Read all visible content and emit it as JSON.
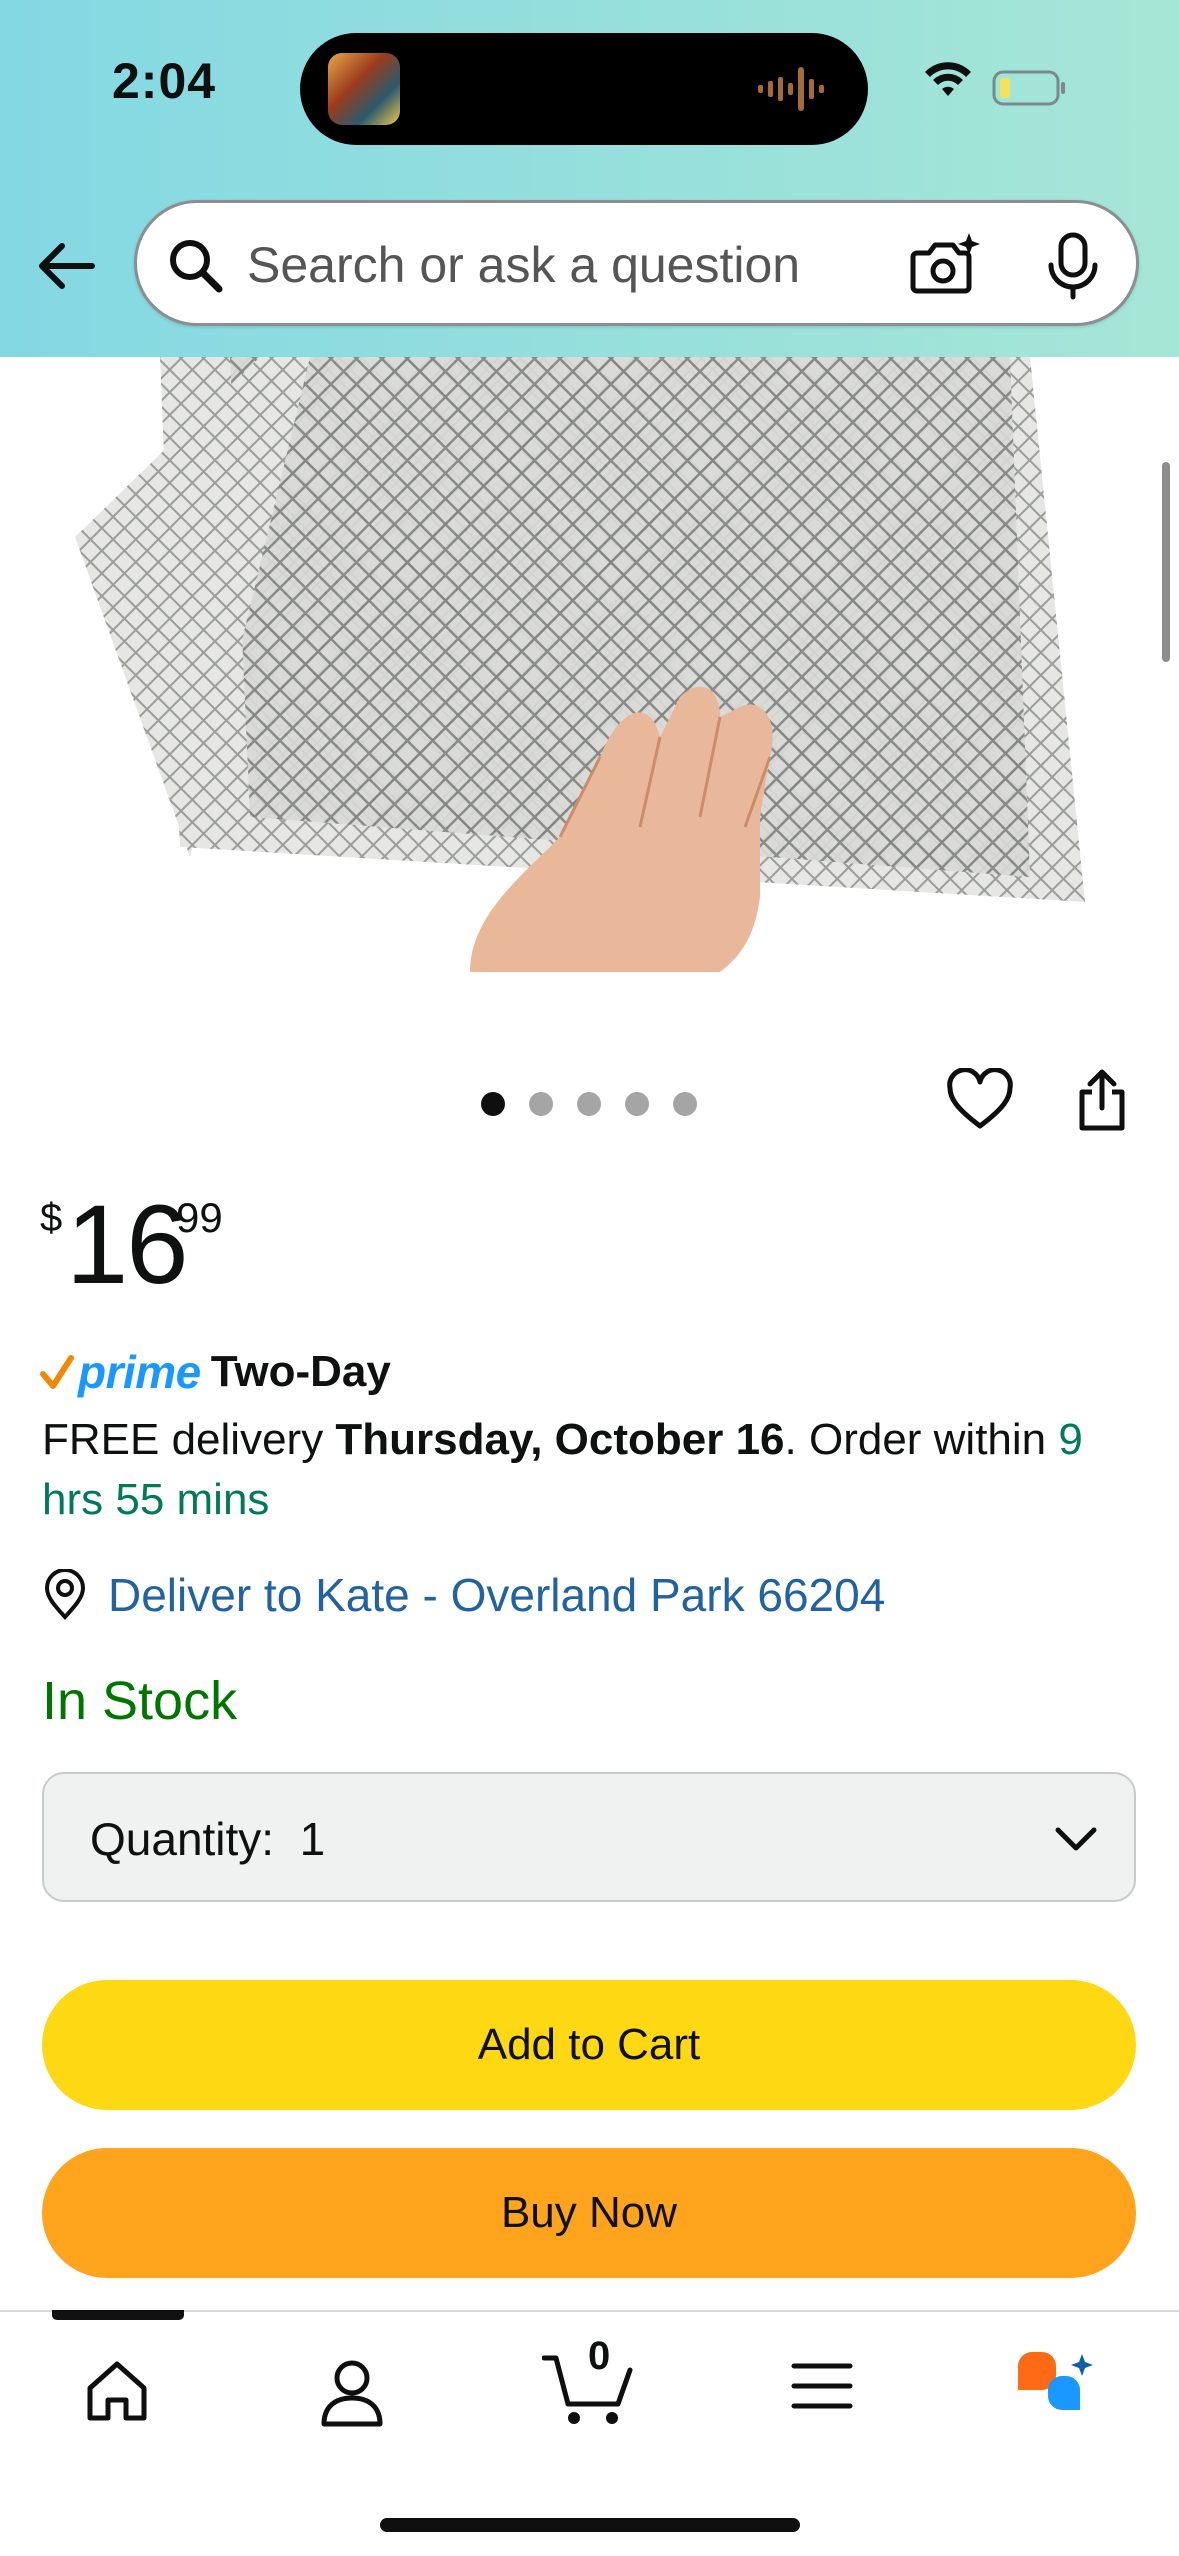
{
  "status_bar": {
    "time": "2:04",
    "battery_color": "#f6e15a"
  },
  "search": {
    "placeholder": "Search or ask a question"
  },
  "icons": {
    "back": "back-arrow-icon",
    "search": "search-icon",
    "camera": "camera-search-icon",
    "mic": "microphone-icon",
    "heart": "heart-icon",
    "share": "share-icon",
    "pin": "location-pin-icon",
    "chevron": "chevron-down-icon",
    "home": "home-icon",
    "user": "user-icon",
    "cart": "cart-icon",
    "menu": "menu-icon",
    "assistant": "assistant-icon"
  },
  "carousel": {
    "count": 5,
    "active_index": 0
  },
  "product": {
    "price_currency": "$",
    "price_whole": "16",
    "price_fraction": "99",
    "prime_label": "prime",
    "prime_type": "Two-Day",
    "delivery_prefix": "FREE delivery ",
    "delivery_date": "Thursday, October 16",
    "delivery_mid": ". Order within ",
    "delivery_countdown": "9 hrs 55 mins",
    "deliver_to": "Deliver to Kate - Overland Park 66204",
    "stock": "In Stock",
    "quantity_label": "Quantity:",
    "quantity_value": "1"
  },
  "buttons": {
    "add_to_cart": "Add to Cart",
    "buy_now": "Buy Now"
  },
  "bottom_nav": {
    "cart_count": "0"
  },
  "colors": {
    "header_start": "#84d8e3",
    "header_end": "#a6e6d6",
    "add_to_cart": "#ffd814",
    "buy_now": "#ffa41c",
    "link": "#2162a1",
    "stock": "#007600",
    "prime": "#1a98ff",
    "countdown": "#007a5a"
  }
}
